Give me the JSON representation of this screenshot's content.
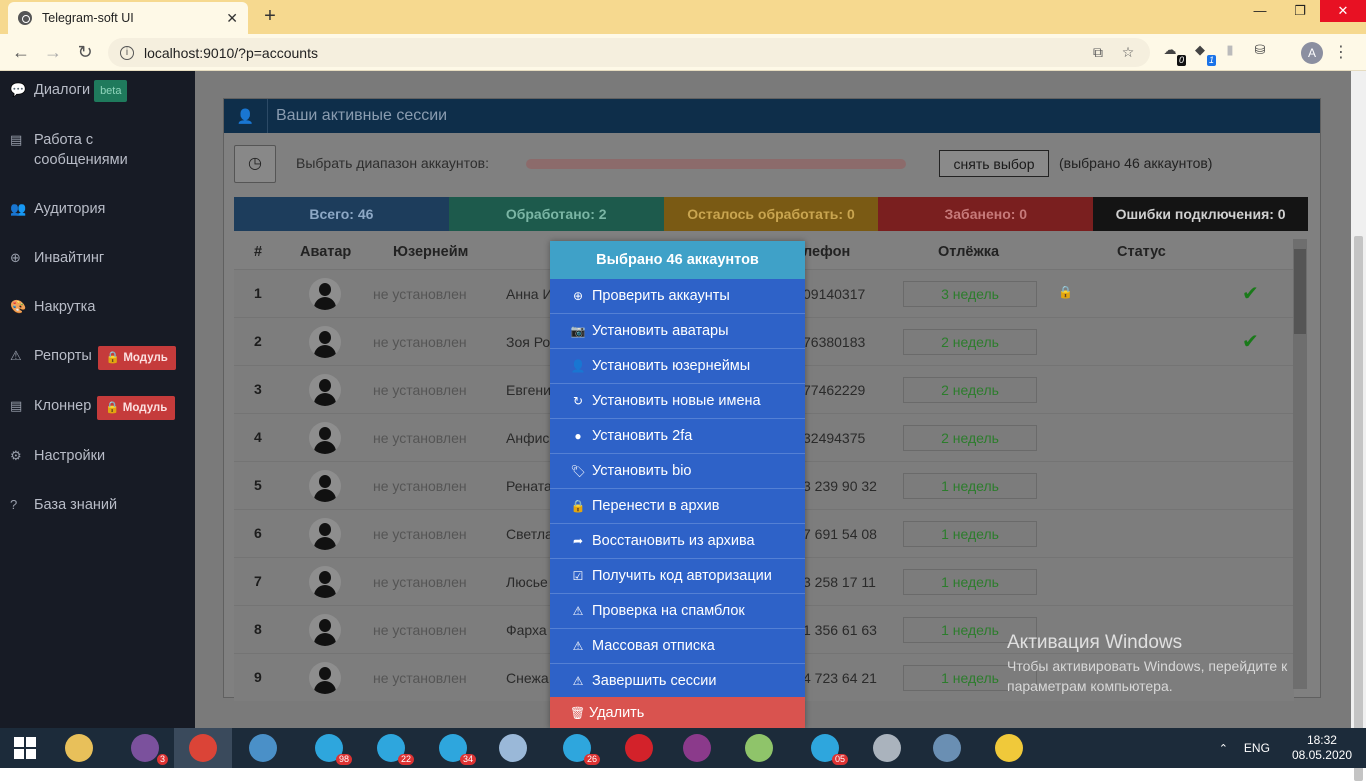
{
  "browser": {
    "tab_title": "Telegram-soft UI",
    "tab_close": "✕",
    "new_tab": "+",
    "url": "localhost:9010/?p=accounts",
    "window_controls": {
      "minimize": "—",
      "maximize": "❐",
      "close": "✕"
    },
    "nav": {
      "back": "←",
      "forward": "→",
      "reload": "↻"
    },
    "info_icon": "i",
    "translate_icon": "⧉",
    "star_icon": "☆",
    "profile_letter": "A",
    "menu_icon": "⋮",
    "extensions": [
      {
        "icon": "☁",
        "badge": "0"
      },
      {
        "icon": "◆",
        "badge": "1"
      },
      {
        "icon": "▮",
        "badge": ""
      },
      {
        "icon": "⛁",
        "badge": ""
      }
    ]
  },
  "sidebar": {
    "items": [
      {
        "icon": "💬",
        "label": "Диалоги",
        "badge": "beta"
      },
      {
        "icon": "▤",
        "label": "Работа с\nсообщениями"
      },
      {
        "icon": "👥",
        "label": "Аудитория"
      },
      {
        "icon": "⊕",
        "label": "Инвайтинг"
      },
      {
        "icon": "🎨",
        "label": "Накрутка"
      },
      {
        "icon": "⚠",
        "label": "Репорты",
        "badge": "🔒 Модуль"
      },
      {
        "icon": "▤",
        "label": "Клоннер",
        "badge": "🔒 Модуль"
      },
      {
        "icon": "⚙",
        "label": "Настройки"
      },
      {
        "icon": "?",
        "label": "База знаний"
      }
    ]
  },
  "panel": {
    "header_icon": "👤",
    "title": "Ваши активные сессии",
    "gauge_icon": "◷",
    "range_label": "Выбрать диапазон аккаунтов:",
    "deselect_label": "снять выбор",
    "selected_text": "(выбрано 46 аккаунтов)",
    "stats": [
      {
        "label": "Всего:  46",
        "bg": "#1d3d5c",
        "fg": "#8da8c5"
      },
      {
        "label": "Обработано:  2",
        "bg": "#1d5a4c",
        "fg": "#7bb6a5"
      },
      {
        "label": "Осталось обработать:  0",
        "bg": "#7a5a14",
        "fg": "#c9a550"
      },
      {
        "label": "Забанено:  0",
        "bg": "#7a1f1f",
        "fg": "#c77a7a"
      },
      {
        "label": "Ошибки подключения:  0",
        "bg": "#141414",
        "fg": "#d0d0d0"
      }
    ],
    "columns": {
      "num": "#",
      "avatar": "Аватар",
      "username": "Юзернейм",
      "phone": "лефон",
      "rest": "Отлёжка",
      "status": "Статус"
    },
    "rows": [
      {
        "num": "1",
        "user": "не установлен",
        "name": "Анна И",
        "phone": "09140317",
        "rest": "3 недель",
        "lock": "🔒",
        "ok": "✔"
      },
      {
        "num": "2",
        "user": "не установлен",
        "name": "Зоя Ро",
        "phone": "76380183",
        "rest": "2 недель",
        "lock": "",
        "ok": "✔"
      },
      {
        "num": "3",
        "user": "не установлен",
        "name": "Евгени",
        "phone": "77462229",
        "rest": "2 недель",
        "lock": "",
        "ok": ""
      },
      {
        "num": "4",
        "user": "не установлен",
        "name": "Анфис",
        "phone": "32494375",
        "rest": "2 недель",
        "lock": "",
        "ok": ""
      },
      {
        "num": "5",
        "user": "не установлен",
        "name": "Рената",
        "phone": "3 239 90 32",
        "rest": "1 недель",
        "lock": "",
        "ok": ""
      },
      {
        "num": "6",
        "user": "не установлен",
        "name": "Светла",
        "phone": "7 691 54 08",
        "rest": "1 недель",
        "lock": "",
        "ok": ""
      },
      {
        "num": "7",
        "user": "не установлен",
        "name": "Люсье",
        "phone": "3 258 17 11",
        "rest": "1 недель",
        "lock": "",
        "ok": ""
      },
      {
        "num": "8",
        "user": "не установлен",
        "name": "Фарха",
        "phone": "1 356 61 63",
        "rest": "1 недель",
        "lock": "",
        "ok": ""
      },
      {
        "num": "9",
        "user": "не установлен",
        "name": "Снежа",
        "phone": "4 723 64 21",
        "rest": "1 недель",
        "lock": "",
        "ok": ""
      }
    ]
  },
  "popup": {
    "title": "Выбрано 46 аккаунтов",
    "items": [
      {
        "icon": "⊕",
        "label": "Проверить аккаунты"
      },
      {
        "icon": "📷",
        "label": "Установить аватары"
      },
      {
        "icon": "👤",
        "label": "Установить юзернеймы"
      },
      {
        "icon": "↻",
        "label": "Установить новые имена"
      },
      {
        "icon": "●",
        "label": "Установить 2fa"
      },
      {
        "icon": "🏷",
        "label": "Установить bio"
      },
      {
        "icon": "🔒",
        "label": "Перенести в архив"
      },
      {
        "icon": "➦",
        "label": "Восстановить из архива"
      },
      {
        "icon": "☑",
        "label": "Получить код авторизации"
      },
      {
        "icon": "⚠",
        "label": "Проверка на спамблок"
      },
      {
        "icon": "⚠",
        "label": "Массовая отписка"
      },
      {
        "icon": "⚠",
        "label": "Завершить сессии"
      }
    ],
    "delete": {
      "icon": "🗑",
      "label": "Удалить"
    }
  },
  "windows_activation": {
    "title": "Активация Windows",
    "line1": "Чтобы активировать Windows, перейдите к",
    "line2": "параметрам компьютера."
  },
  "taskbar": {
    "apps": [
      {
        "name": "file-explorer",
        "color": "#e8c05a",
        "badge": ""
      },
      {
        "name": "viber",
        "color": "#7b519d",
        "badge": "3"
      },
      {
        "name": "chrome",
        "color": "#db4437",
        "badge": ""
      },
      {
        "name": "control-panel",
        "color": "#4a90c8",
        "badge": ""
      },
      {
        "name": "telegram",
        "color": "#2ea6dd",
        "badge": "98"
      },
      {
        "name": "telegram",
        "color": "#2ea6dd",
        "badge": "22"
      },
      {
        "name": "telegram",
        "color": "#2ea6dd",
        "badge": "34"
      },
      {
        "name": "notes",
        "color": "#9ab8d8",
        "badge": ""
      },
      {
        "name": "telegram",
        "color": "#2ea6dd",
        "badge": "26"
      },
      {
        "name": "opera",
        "color": "#d3222a",
        "badge": ""
      },
      {
        "name": "winrar",
        "color": "#8b3a8b",
        "badge": ""
      },
      {
        "name": "notepad-plus",
        "color": "#8fc46a",
        "badge": ""
      },
      {
        "name": "telegram",
        "color": "#2ea6dd",
        "badge": "05"
      },
      {
        "name": "performance",
        "color": "#aab3bd",
        "badge": ""
      },
      {
        "name": "calculator",
        "color": "#6a8fb3",
        "badge": ""
      },
      {
        "name": "python",
        "color": "#f0c93a",
        "badge": ""
      }
    ],
    "tray_arrow": "⌃",
    "lang": "ENG",
    "time": "18:32",
    "date": "08.05.2020"
  }
}
